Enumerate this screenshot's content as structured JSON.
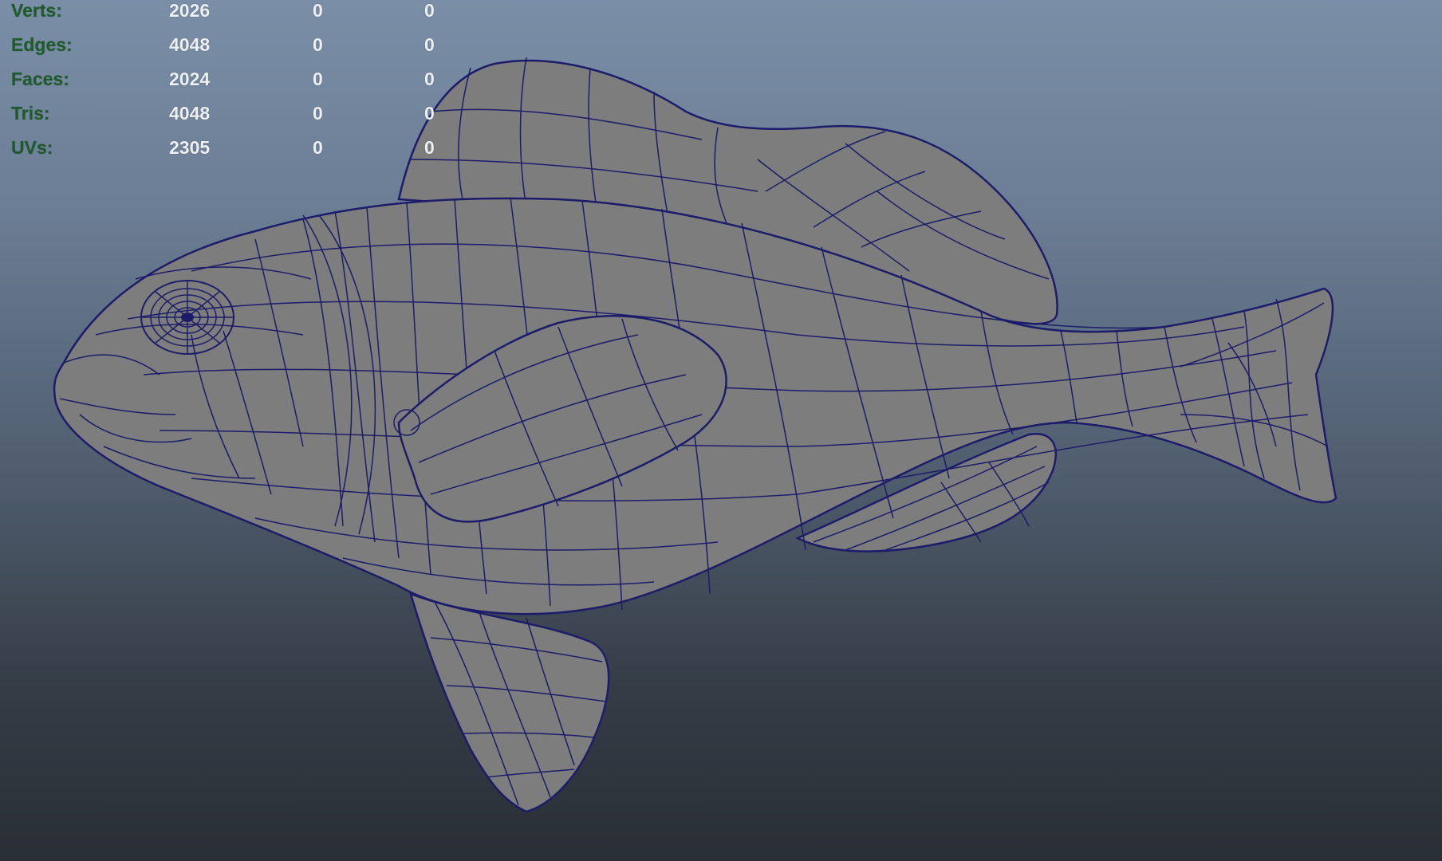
{
  "viewport": {
    "background_top": "#7a8ea7",
    "background_bottom": "#2a2f36",
    "wireframe_color": "#1c1c6a",
    "mesh_color": "#7d7d7d"
  },
  "heads_up_display": {
    "rows": [
      {
        "label": "Verts:",
        "values": [
          "2026",
          "0",
          "0"
        ]
      },
      {
        "label": "Edges:",
        "values": [
          "4048",
          "0",
          "0"
        ]
      },
      {
        "label": "Faces:",
        "values": [
          "2024",
          "0",
          "0"
        ]
      },
      {
        "label": "Tris:",
        "values": [
          "4048",
          "0",
          "0"
        ]
      },
      {
        "label": "UVs:",
        "values": [
          "2305",
          "0",
          "0"
        ]
      }
    ]
  }
}
